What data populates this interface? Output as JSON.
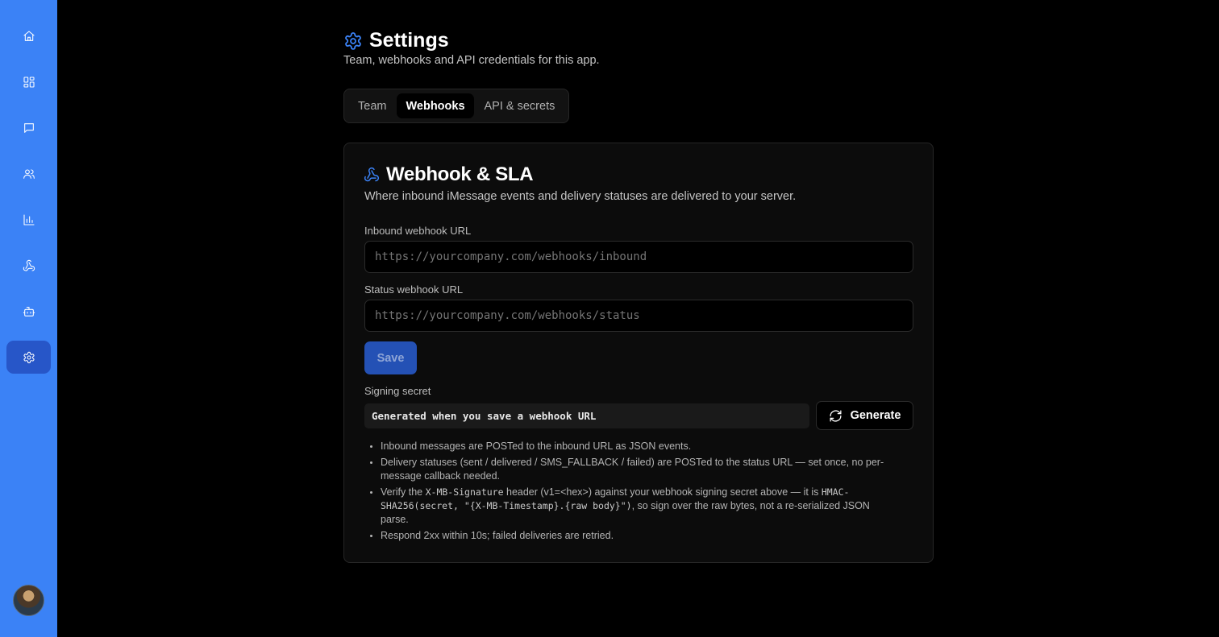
{
  "sidebar": {
    "items": [
      {
        "icon": "home-icon"
      },
      {
        "icon": "dashboard-icon"
      },
      {
        "icon": "chat-icon"
      },
      {
        "icon": "users-icon"
      },
      {
        "icon": "bar-chart-icon"
      },
      {
        "icon": "webhook-icon"
      },
      {
        "icon": "bot-icon"
      },
      {
        "icon": "gear-icon",
        "active": true
      }
    ],
    "avatar": "user-avatar"
  },
  "page": {
    "title": "Settings",
    "subtitle": "Team, webhooks and API credentials for this app."
  },
  "tabs": [
    {
      "label": "Team"
    },
    {
      "label": "Webhooks",
      "active": true
    },
    {
      "label": "API & secrets"
    }
  ],
  "card": {
    "title": "Webhook & SLA",
    "subtitle": "Where inbound iMessage events and delivery statuses are delivered to your server.",
    "inbound": {
      "label": "Inbound webhook URL",
      "placeholder": "https://yourcompany.com/webhooks/inbound"
    },
    "status": {
      "label": "Status webhook URL",
      "placeholder": "https://yourcompany.com/webhooks/status"
    },
    "save_label": "Save",
    "secret": {
      "label": "Signing secret",
      "value": "Generated when you save a webhook URL",
      "generate_label": "Generate"
    },
    "notes": {
      "n1": "Inbound messages are POSTed to the inbound URL as JSON events.",
      "n2": "Delivery statuses (sent / delivered / SMS_FALLBACK / failed) are POSTed to the status URL — set once, no per-message callback needed.",
      "n3a": "Verify the ",
      "n3b": "X-MB-Signature",
      "n3c": " header (v1=<hex>) against your webhook signing secret above — it is ",
      "n3d": "HMAC-SHA256(secret, \"{X-MB-Timestamp}.{raw body}\")",
      "n3e": ", so sign over the raw bytes, not a re-serialized JSON parse.",
      "n4": "Respond 2xx within 10s; failed deliveries are retried."
    }
  },
  "colors": {
    "accent": "#3b82f6",
    "sidebar_active": "#2756c8",
    "background": "#000000",
    "card": "#0c0c0c"
  }
}
